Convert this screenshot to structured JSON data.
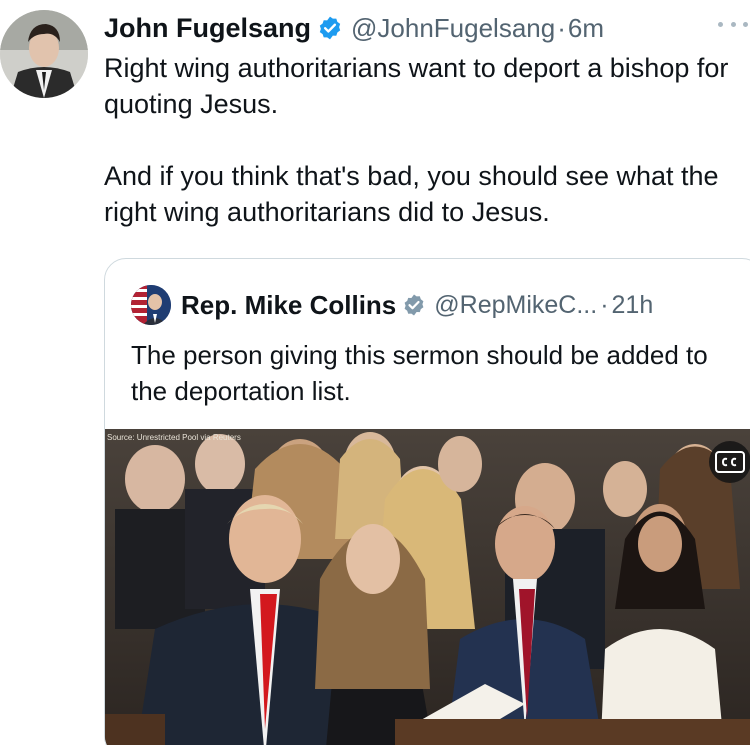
{
  "tweet": {
    "author": {
      "display_name": "John Fugelsang",
      "handle": "@JohnFugelsang",
      "time": "6m",
      "verified_color": "#1d9bf0"
    },
    "paragraphs": [
      "Right wing authoritarians want to deport a bishop for quoting Jesus.",
      "And if you think that's bad, you should see what the right wing authoritarians did to Jesus."
    ],
    "more_icon": "ellipsis-icon"
  },
  "quote": {
    "author": {
      "display_name": "Rep. Mike Collins",
      "handle": "@RepMikeC...",
      "time": "21h",
      "verified_color": "#829aab"
    },
    "text": "The person giving this sermon should be added to the deportation list.",
    "media": {
      "source_label": "Source: Unrestricted Pool via Reuters",
      "badge_icon": "closed-captions-icon"
    }
  },
  "separator": "·"
}
